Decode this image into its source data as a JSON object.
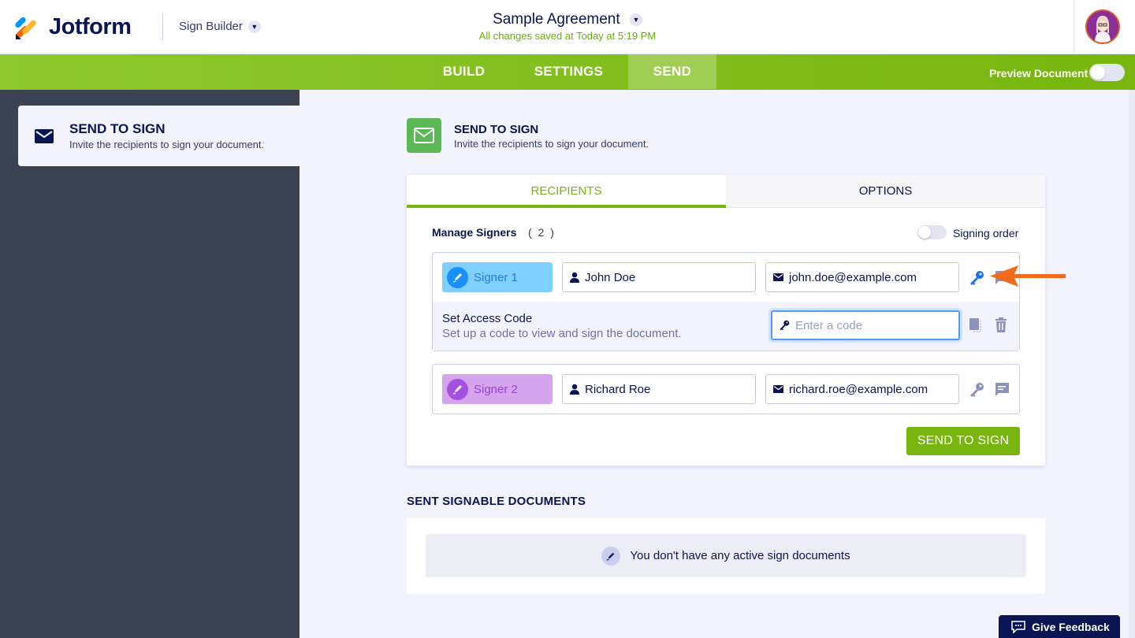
{
  "header": {
    "brand": "Jotform",
    "builder": "Sign Builder",
    "doc_title": "Sample Agreement",
    "saved_status": "All changes saved at Today at 5:19 PM"
  },
  "nav": {
    "tabs": [
      {
        "label": "BUILD",
        "active": false
      },
      {
        "label": "SETTINGS",
        "active": false
      },
      {
        "label": "SEND",
        "active": true
      }
    ],
    "preview_label": "Preview Document",
    "preview_on": false
  },
  "sidebar": {
    "item": {
      "title": "SEND TO SIGN",
      "subtitle": "Invite the recipients to sign your document.",
      "icon": "envelope-icon"
    }
  },
  "main": {
    "title": "SEND TO SIGN",
    "subtitle": "Invite the recipients to sign your document.",
    "tabs": [
      {
        "label": "RECIPIENTS",
        "active": true
      },
      {
        "label": "OPTIONS",
        "active": false
      }
    ],
    "manage_label": "Manage Signers",
    "signer_count": "( 2 )",
    "signing_order_label": "Signing order",
    "signing_order_on": false,
    "signers": [
      {
        "label": "Signer 1",
        "name": "John Doe",
        "email": "john.doe@example.com",
        "color": "#7fcfff",
        "access_code": {
          "title": "Set Access Code",
          "subtitle": "Set up a code to view and sign the document.",
          "value": "",
          "placeholder": "Enter a code"
        }
      },
      {
        "label": "Signer 2",
        "name": "Richard Roe",
        "email": "richard.roe@example.com",
        "color": "#d4a4ec"
      }
    ],
    "send_button": "SEND TO SIGN",
    "sent_title": "SENT SIGNABLE DOCUMENTS",
    "empty_message": "You don't have any active sign documents"
  },
  "feedback_button": "Give Feedback",
  "colors": {
    "brand_green": "#78b50e",
    "navy": "#0a1551",
    "focus_blue": "#4e9df8",
    "annotation_arrow": "#f26b1d"
  }
}
